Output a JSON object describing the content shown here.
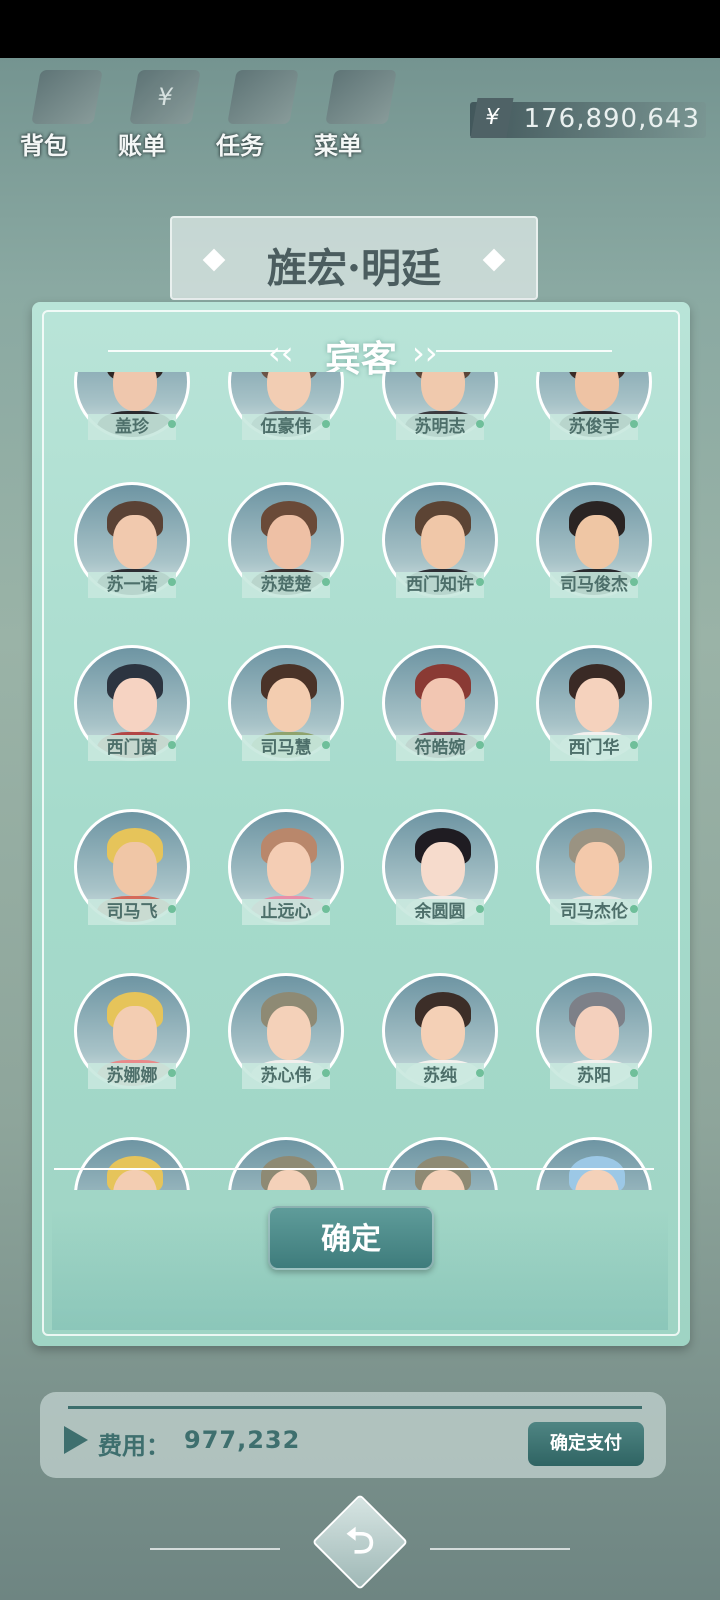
{
  "hud": {
    "buttons": [
      {
        "label": "背包",
        "icon": "bag-icon"
      },
      {
        "label": "账单",
        "icon": "bill-icon",
        "glyph": "¥"
      },
      {
        "label": "任务",
        "icon": "task-icon"
      },
      {
        "label": "菜单",
        "icon": "menu-icon"
      }
    ],
    "currency_symbol": "¥",
    "money": "176,890,643"
  },
  "location": {
    "title": "旌宏·明廷"
  },
  "panel": {
    "title": "宾客",
    "confirm_label": "确定"
  },
  "guests": [
    {
      "name": "盖珍",
      "hair": "#2f2624",
      "face": "#efc7ad",
      "shirt": "#2a2a2e"
    },
    {
      "name": "伍豪伟",
      "hair": "#6b5346",
      "face": "#f2cdb3",
      "shirt": "#5f6b70"
    },
    {
      "name": "苏明志",
      "hair": "#5a4538",
      "face": "#f0c9ad",
      "shirt": "#3b3b40"
    },
    {
      "name": "苏俊宇",
      "hair": "#3a2c27",
      "face": "#eec3a4",
      "shirt": "#2a2a2e"
    },
    {
      "name": "苏一诺",
      "hair": "#5a4235",
      "face": "#f1c9ae",
      "shirt": "#2d2d33"
    },
    {
      "name": "苏楚楚",
      "hair": "#6a4a38",
      "face": "#eec0a5",
      "shirt": "#3a3030"
    },
    {
      "name": "西门知许",
      "hair": "#5c4434",
      "face": "#f0c7a8",
      "shirt": "#2d2d33"
    },
    {
      "name": "司马俊杰",
      "hair": "#2a2423",
      "face": "#efc6a4",
      "shirt": "#2a2a2e"
    },
    {
      "name": "西门茵",
      "hair": "#2c3440",
      "face": "#f6d3c2",
      "shirt": "#b24545"
    },
    {
      "name": "司马慧",
      "hair": "#4a3328",
      "face": "#f3cdb0",
      "shirt": "#8fa36e"
    },
    {
      "name": "符皓婉",
      "hair": "#8a3a34",
      "face": "#f2c6b2",
      "shirt": "#7a3b52"
    },
    {
      "name": "西门华",
      "hair": "#3a2a25",
      "face": "#f5d2bd",
      "shirt": "#f3f1ef"
    },
    {
      "name": "司马飞",
      "hair": "#e6c45a",
      "face": "#f0c6a6",
      "shirt": "#d56a5a"
    },
    {
      "name": "止远心",
      "hair": "#b9876b",
      "face": "#f4cdb4",
      "shirt": "#e88fa8"
    },
    {
      "name": "余圆圆",
      "hair": "#1f1c22",
      "face": "#f6dbcc",
      "shirt": "#f0ebe8"
    },
    {
      "name": "司马杰伦",
      "hair": "#9a9382",
      "face": "#f3c9ab",
      "shirt": "#e8e6e3"
    },
    {
      "name": "苏娜娜",
      "hair": "#e6c45a",
      "face": "#f3cdb2",
      "shirt": "#e98a8a"
    },
    {
      "name": "苏心伟",
      "hair": "#8e8a74",
      "face": "#f4d1b9",
      "shirt": "#f2efed"
    },
    {
      "name": "苏纯",
      "hair": "#3c2e28",
      "face": "#f4d0b6",
      "shirt": "#f4f1ee"
    },
    {
      "name": "苏阳",
      "hair": "#7d8088",
      "face": "#f4d0bd",
      "shirt": "#f2f0ee"
    },
    {
      "name": "",
      "hair": "#e6c45a",
      "face": "#f3cdb2",
      "shirt": "#e98a8a"
    },
    {
      "name": "",
      "hair": "#8e8a74",
      "face": "#f4d1b9",
      "shirt": "#f2efed"
    },
    {
      "name": "",
      "hair": "#8e8a74",
      "face": "#f4d1b9",
      "shirt": "#f2efed"
    },
    {
      "name": "",
      "hair": "#9cc8e6",
      "face": "#f4d1b9",
      "shirt": "#f2efed"
    }
  ],
  "cost": {
    "label": "费用：",
    "value": "977,232",
    "pay_label": "确定支付"
  },
  "nav": {
    "back_icon": "back-arrow-icon",
    "back_glyph": "⮌"
  }
}
